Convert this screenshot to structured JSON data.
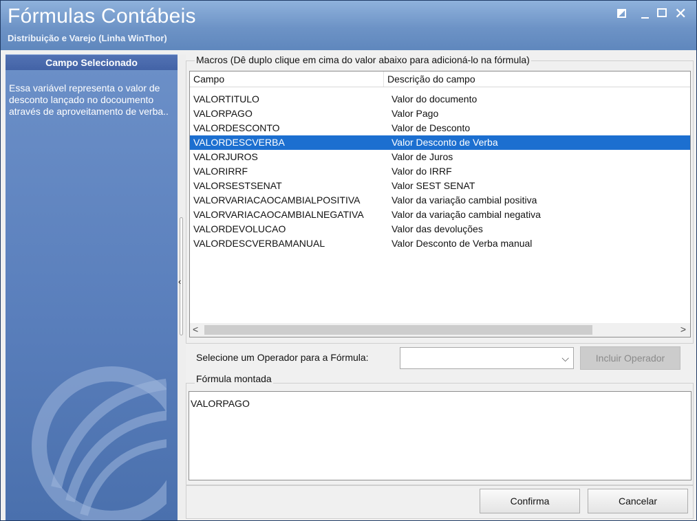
{
  "window": {
    "title": "Fórmulas Contábeis",
    "subtitle": "Distribuição e Varejo (Linha WinThor)",
    "controls": {
      "restore_icon": "restore-icon",
      "minimize_icon": "minimize-icon",
      "maximize_icon": "maximize-icon",
      "close_glyph": "✕"
    }
  },
  "sidebar": {
    "header": "Campo Selecionado",
    "description": "Essa variável representa o valor de desconto lançado no docoumento através de aproveitamento de verba..",
    "splitter_arrow": "‹"
  },
  "macros": {
    "group_label": "Macros (Dê duplo clique em cima do valor abaixo para adicioná-lo na fórmula)",
    "columns": [
      "Campo",
      "Descrição do campo"
    ],
    "rows": [
      {
        "campo": "VALORTITULO",
        "descricao": "Valor do documento"
      },
      {
        "campo": "VALORPAGO",
        "descricao": "Valor Pago"
      },
      {
        "campo": "VALORDESCONTO",
        "descricao": "Valor de Desconto"
      },
      {
        "campo": "VALORDESCVERBA",
        "descricao": "Valor Desconto de Verba"
      },
      {
        "campo": "VALORJUROS",
        "descricao": "Valor de Juros"
      },
      {
        "campo": "VALORIRRF",
        "descricao": "Valor do IRRF"
      },
      {
        "campo": "VALORSESTSENAT",
        "descricao": "Valor SEST SENAT"
      },
      {
        "campo": "VALORVARIACAOCAMBIALPOSITIVA",
        "descricao": "Valor da variação cambial positiva"
      },
      {
        "campo": "VALORVARIACAOCAMBIALNEGATIVA",
        "descricao": "Valor da variação cambial negativa"
      },
      {
        "campo": "VALORDEVOLUCAO",
        "descricao": "Valor das devoluções"
      },
      {
        "campo": "VALORDESCVERBAMANUAL",
        "descricao": "Valor Desconto de Verba manual"
      }
    ],
    "selected_row": "VALORDESCVERBA",
    "scroll_left": "<",
    "scroll_right": ">"
  },
  "operator": {
    "label": "Selecione um Operador para a Fórmula:",
    "selected": "",
    "chevron": "⌵",
    "include_button": "Incluir Operador"
  },
  "formula": {
    "group_label": "Fórmula montada",
    "value": "VALORPAGO"
  },
  "buttons": {
    "confirm": "Confirma",
    "cancel": "Cancelar"
  },
  "colors": {
    "title_bar": "#7da3d3",
    "sidebar": "#5a7fbc",
    "selection": "#1c6fd0"
  }
}
